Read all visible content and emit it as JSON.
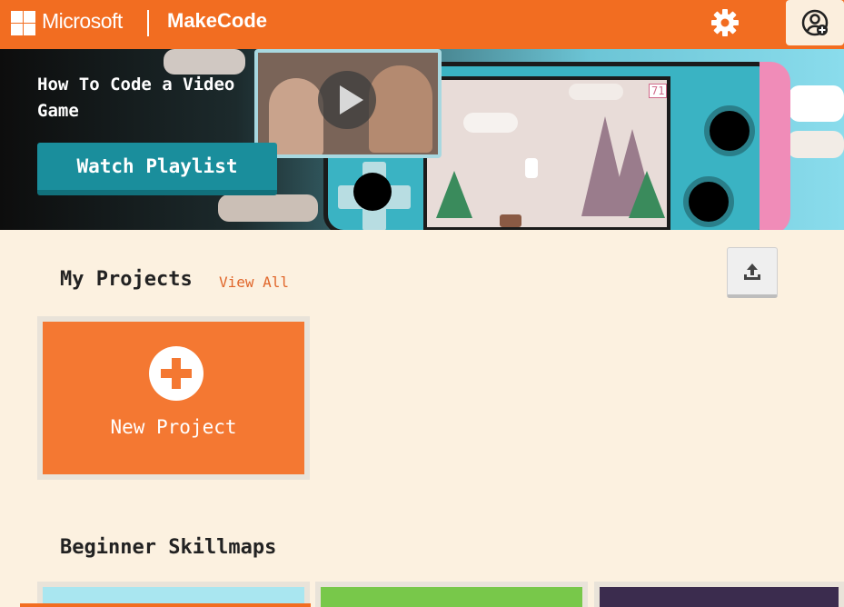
{
  "header": {
    "brand": "Microsoft",
    "product": "MakeCode",
    "settings_icon": "gear-icon",
    "account_icon": "user-add-icon",
    "color": "#f26d21"
  },
  "hero": {
    "title": "How To Code a Video Game",
    "button_label": "Watch Playlist",
    "video_icon": "play-icon",
    "counter": "71"
  },
  "projects": {
    "heading": "My Projects",
    "view_all": "View All",
    "import_icon": "upload-icon",
    "new_project_label": "New Project",
    "new_project_icon": "plus-icon"
  },
  "skillmaps": {
    "heading": "Beginner Skillmaps",
    "cards": [
      {
        "id": "skillmap-1"
      },
      {
        "id": "skillmap-2"
      },
      {
        "id": "skillmap-3"
      }
    ]
  }
}
